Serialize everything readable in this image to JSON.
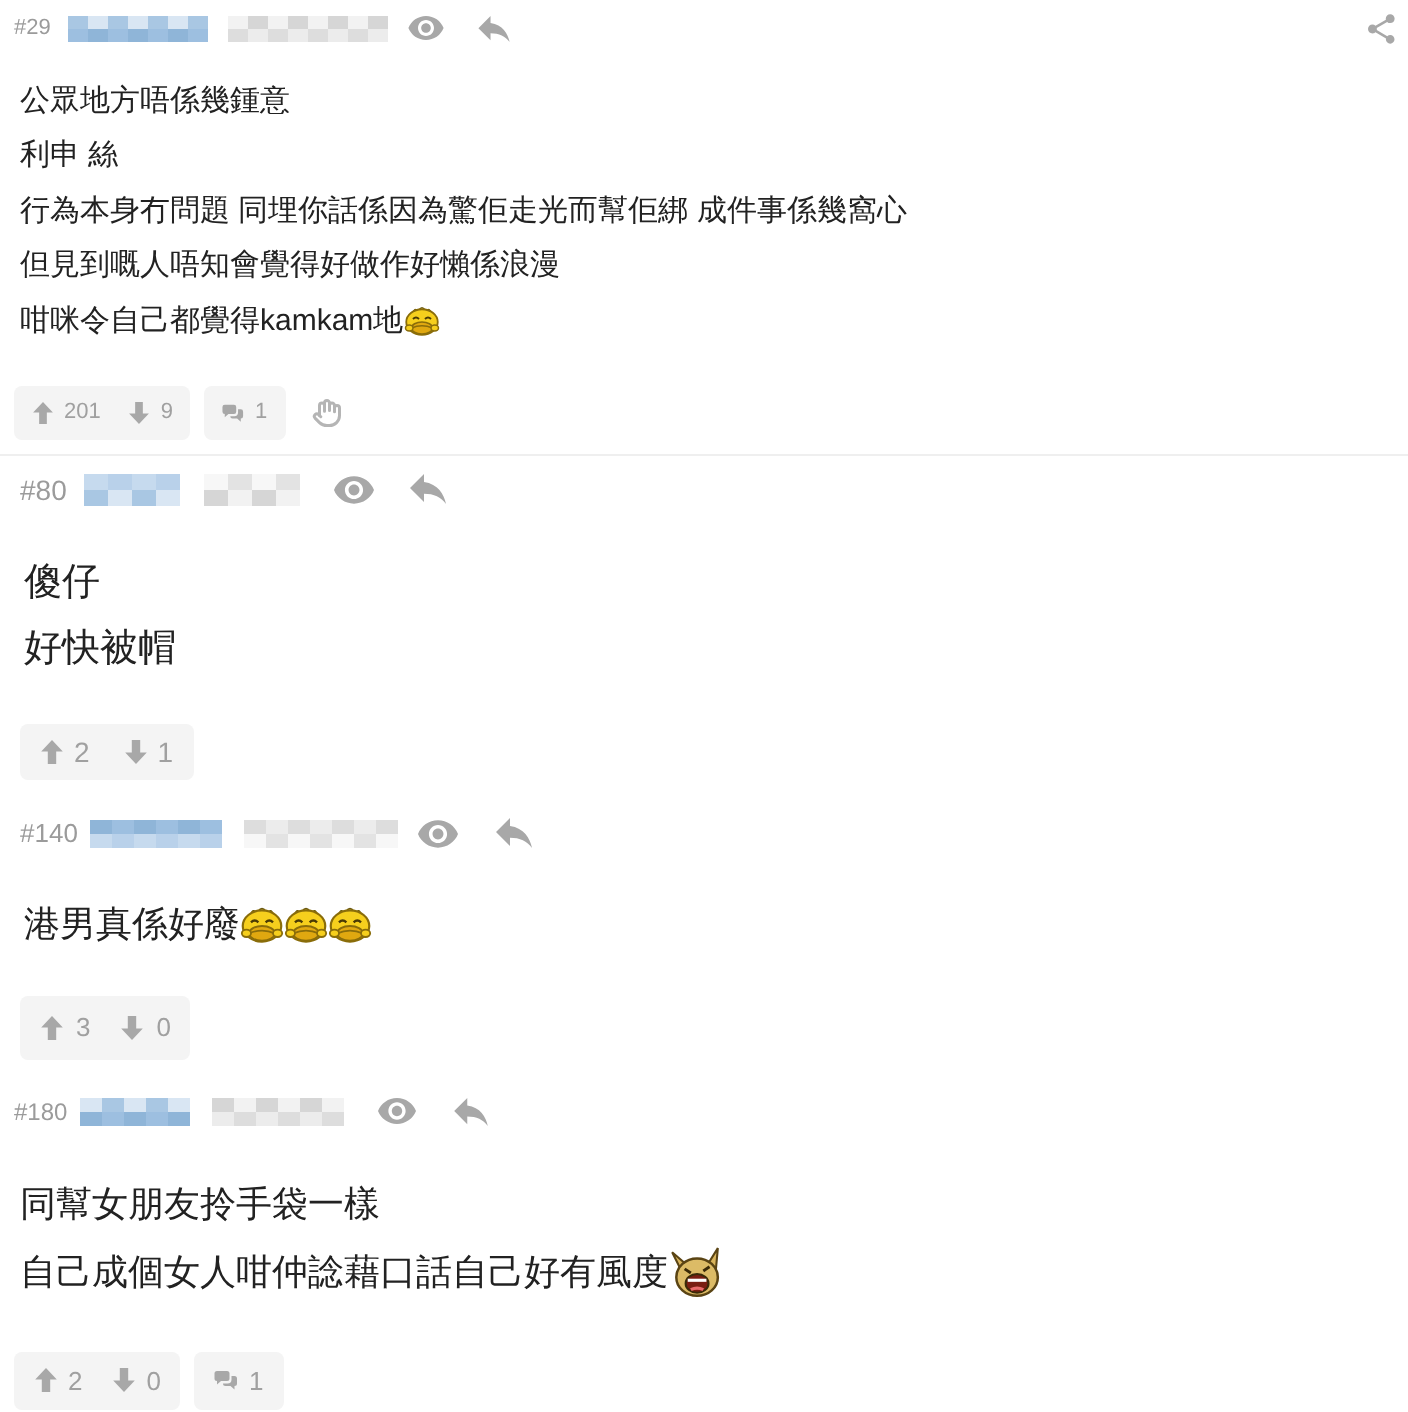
{
  "posts": [
    {
      "number": "#29",
      "lines": [
        {
          "text": "公眾地方唔係幾鍾意"
        },
        {
          "text": "利申 絲"
        },
        {
          "text": "行為本身冇問題 同埋你話係因為驚佢走光而幫佢綁 成件事係幾窩心"
        },
        {
          "text": "但見到嘅人唔知會覺得好做作好懶係浪漫"
        },
        {
          "text": "咁咪令自己都覺得kamkam地",
          "emoticons": [
            {
              "kind": "grin"
            }
          ]
        }
      ],
      "upvotes": "201",
      "downvotes": "9",
      "comments": "1",
      "share_button": true,
      "hide_button": true
    },
    {
      "number": "#80",
      "lines": [
        {
          "text": "傻仔"
        },
        {
          "text": "好快被帽"
        }
      ],
      "upvotes": "2",
      "downvotes": "1",
      "share_button": false,
      "hide_button": false
    },
    {
      "number": "#140",
      "lines": [
        {
          "text": "港男真係好廢",
          "emoticons": [
            {
              "kind": "grin"
            },
            {
              "kind": "grin"
            },
            {
              "kind": "grin"
            }
          ]
        }
      ],
      "upvotes": "3",
      "downvotes": "0",
      "share_button": false,
      "hide_button": false
    },
    {
      "number": "#180",
      "lines": [
        {
          "text": "同幫女朋友拎手袋一樣"
        },
        {
          "text": "自己成個女人咁仲諗藉口話自己好有風度",
          "emoticons": [
            {
              "kind": "laugh"
            }
          ]
        }
      ],
      "upvotes": "2",
      "downvotes": "0",
      "comments": "1",
      "share_button": false,
      "hide_button": false
    }
  ]
}
